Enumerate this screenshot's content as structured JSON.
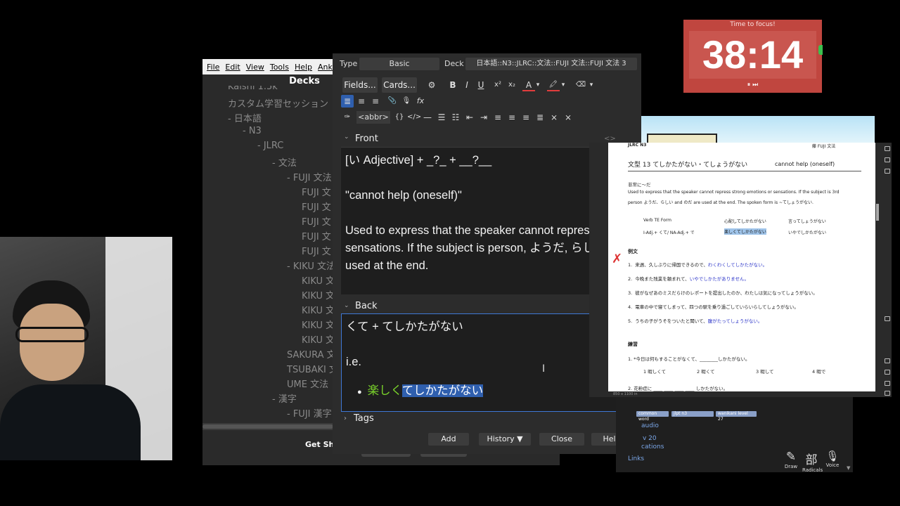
{
  "anki_main": {
    "menu": [
      "File",
      "Edit",
      "View",
      "Tools",
      "Help",
      "Anki"
    ],
    "title": "Decks",
    "deck_tree": [
      {
        "label": "Kaishi 1.5k",
        "indent": 0
      },
      {
        "label": "カスタム学習セッション",
        "indent": 0
      },
      {
        "label": "- 日本語",
        "indent": 0
      },
      {
        "label": "- N3",
        "indent": 1
      },
      {
        "label": "- JLRC",
        "indent": 2
      },
      {
        "label": "- 文法",
        "indent": 3
      },
      {
        "label": "- FUJI 文法",
        "indent": 4
      },
      {
        "label": "FUJI 文",
        "indent": 5
      },
      {
        "label": "FUJI 文",
        "indent": 5
      },
      {
        "label": "FUJI 文",
        "indent": 5
      },
      {
        "label": "FUJI 文",
        "indent": 5
      },
      {
        "label": "FUJI 文",
        "indent": 5
      },
      {
        "label": "- KIKU 文法",
        "indent": 4
      },
      {
        "label": "KIKU 文",
        "indent": 5
      },
      {
        "label": "KIKU 文",
        "indent": 5
      },
      {
        "label": "KIKU 文",
        "indent": 5
      },
      {
        "label": "KIKU 文",
        "indent": 5
      },
      {
        "label": "KIKU 文",
        "indent": 5
      },
      {
        "label": "SAKURA 文",
        "indent": 4
      },
      {
        "label": "TSUBAKI 文",
        "indent": 4
      },
      {
        "label": "UME 文法",
        "indent": 4
      },
      {
        "label": "- 漢字",
        "indent": 3
      },
      {
        "label": "- FUJI 漢字",
        "indent": 4
      }
    ],
    "get_shared": "Get Sh"
  },
  "add_dialog": {
    "type_label": "Type",
    "type_value": "Basic",
    "deck_label": "Deck",
    "deck_value": "日本語::N3::JLRC::文法::FUJI 文法::FUJI 文法 3",
    "fields_button": "Fields...",
    "cards_button": "Cards...",
    "toolbar_row1": [
      "⚙",
      "B",
      "I",
      "U",
      "x²",
      "x₂",
      "A",
      "▾",
      "🖍",
      "▾",
      "⌫",
      "▾"
    ],
    "toolbar_row2": [
      "≣",
      "≡",
      "≡",
      "📎",
      "🎙",
      "fx"
    ],
    "abbr_button": "<abbr>",
    "front": {
      "label": "Front",
      "line1": "[い Adjective] + _?_ + __?__",
      "line2": "\"cannot help (oneself)\"",
      "line3": "Used to express that the speaker cannot repress strong emotions or sensations. If the subject is person, ようだ, らしい, and のだ are used at the end."
    },
    "back": {
      "label": "Back",
      "line1": "くて + てしかたがない",
      "line2": "i.e.",
      "bullet_green": "楽しく",
      "bullet_selected": "てしかたがない"
    },
    "tags_label": "Tags",
    "buttons": {
      "add": "Add",
      "history": "History ▼",
      "close": "Close",
      "help": "Help"
    }
  },
  "timer": {
    "caption": "Time to focus!",
    "time": "38:14",
    "controls": "⏸ ⏭"
  },
  "pdf": {
    "header_left": "JLRC N3",
    "header_right": "藤  FUJI  文法",
    "title": "文型 13   てしかたがない・てしょうがない",
    "title_en": "cannot help (oneself)",
    "subtitle": "非常に～だ",
    "desc1": "Used to express that the speaker cannot repress strong emotions or sensations. If the subject is 3rd",
    "desc2": "person ようだ、らしい and のだ are used at the end. The spoken form is ~てしょうがない.",
    "form_row1": [
      "Verb TE Form",
      "心配してしかたがない",
      "言ってしょうがない"
    ],
    "form_row2": [
      "I-Adj.+  くて/ NA-Adj.+ で",
      "楽しくてしかたがない",
      "いやでしかたがない"
    ],
    "examples_label": "例文",
    "examples": [
      {
        "n": "1.",
        "text": "来週、久しぶりに帰国できるので、",
        "hl": "わくわくしてしかたがない。"
      },
      {
        "n": "2.",
        "text": "今晩また残業を頼まれて、",
        "hl": "いやでしかたがありません。"
      },
      {
        "n": "3.",
        "text": "彼がなぜあのミスだらけのレポートを提出したのか、わたしは気になってしょうがない。",
        "hl": ""
      },
      {
        "n": "4.",
        "text": "電車の中で寝てしまって、四つの駅を乗り過ごしていらいらしてしょうがない。",
        "hl": ""
      },
      {
        "n": "5.",
        "text": "うちの子がうそをついたと聞いて、",
        "hl": "腹がたってしょうがない。"
      }
    ],
    "practice_label": "練習",
    "practice1": "1. *今日は何もすることがなくて、________しかたがない。",
    "choices": [
      "1 暇しくて",
      "2 暇くて",
      "3 暇して",
      "4 暇で"
    ],
    "practice2": "2. 花粉症に ____ ____ ____ ____ しかたがない。",
    "footer": "850 x 1100 in"
  },
  "reviewer": {
    "tags": [
      "common word",
      "jlpt n3",
      "wanikani level 27"
    ],
    "links": [
      "audio",
      "v 20",
      "cations",
      "Links"
    ],
    "tools": [
      {
        "icon": "✎",
        "label": "Draw"
      },
      {
        "icon": "部",
        "label": "Radicals"
      },
      {
        "icon": "🎙",
        "label": "Voice"
      }
    ]
  },
  "colors": {
    "timer_bg": "#c0463f",
    "selection": "#2f5fae",
    "highlight_green": "#7ad32b",
    "link_blue": "#7ba7e8"
  }
}
